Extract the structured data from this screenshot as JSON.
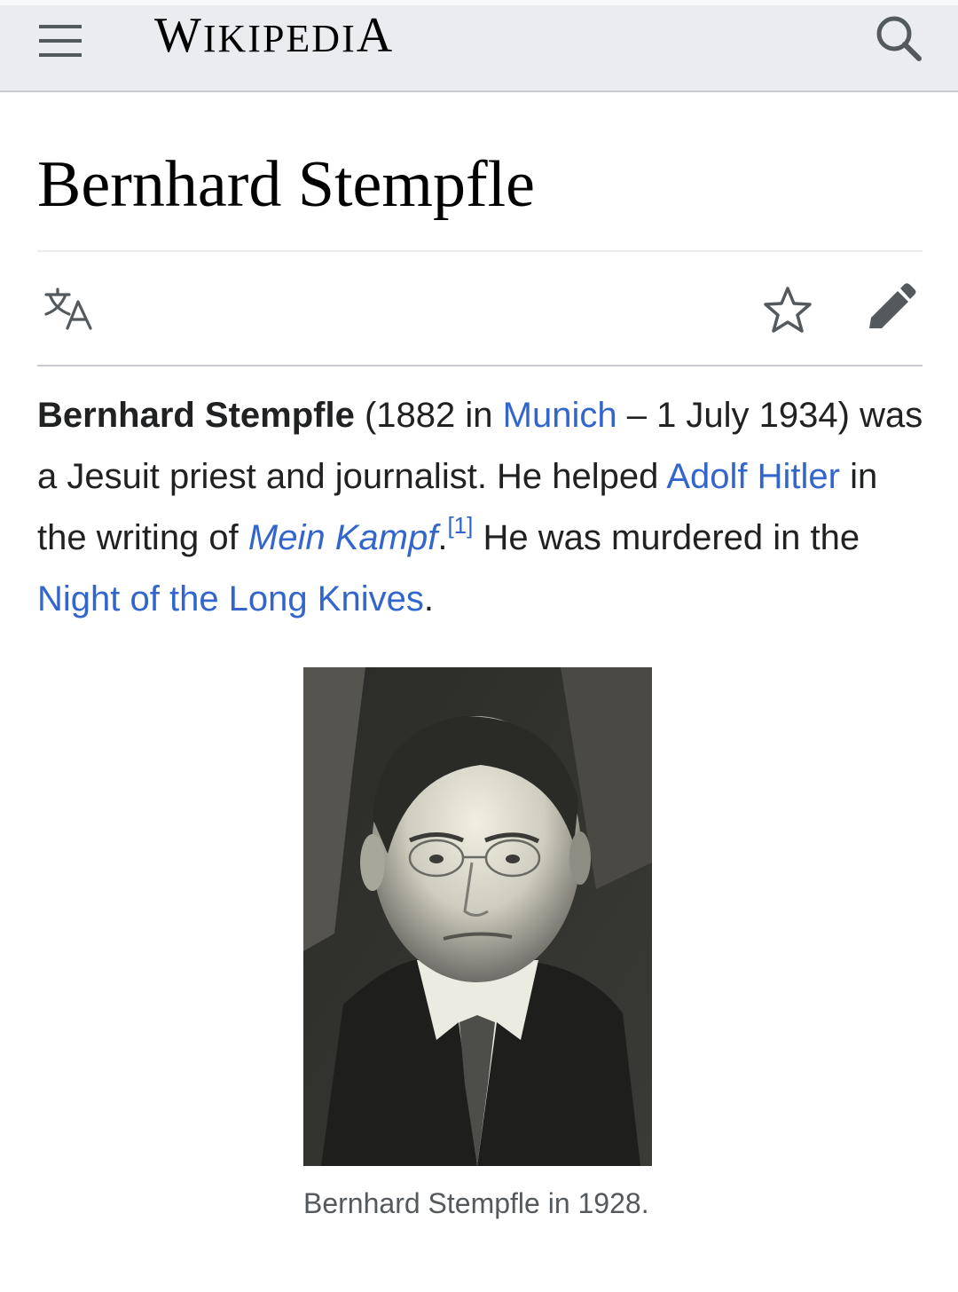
{
  "header": {
    "wordmark_first": "W",
    "wordmark_rest_1": "IKIPEDI",
    "wordmark_last": "A",
    "menu_icon": "hamburger-menu-icon",
    "search_icon": "search-icon"
  },
  "article": {
    "title": "Bernhard Stempfle",
    "actions": {
      "language_icon": "language-icon",
      "watch_icon": "star-icon",
      "edit_icon": "edit-pencil-icon"
    },
    "lead": {
      "bold_name": "Bernhard Stempfle",
      "t1": " (1882 in ",
      "link_munich": "Munich",
      "t2": " – 1 July 1934) was a Jesuit priest and journalist. He helped ",
      "link_hitler": "Adolf Hitler",
      "t3": " in the writing of ",
      "link_mein_kampf": "Mein Kampf",
      "t4": ".",
      "ref": "[1]",
      "t5": " He was murdered in the ",
      "link_night": "Night of the Long Knives",
      "t6": "."
    },
    "infobox": {
      "caption": "Bernhard Stempfle in 1928."
    }
  }
}
